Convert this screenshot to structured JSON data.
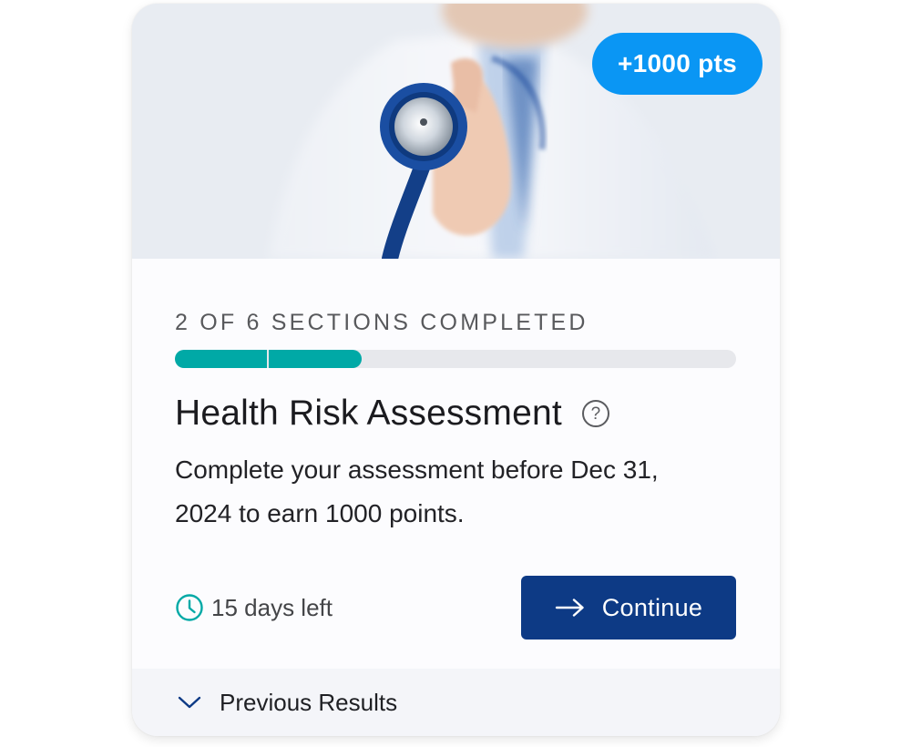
{
  "badge": {
    "text": "+1000 pts",
    "color": "#0a96f4"
  },
  "progress": {
    "label": "2 of 6 sections completed",
    "completed": 2,
    "total": 6,
    "fill_color": "#00a9a6"
  },
  "title": "Health Risk Assessment",
  "help_icon": {
    "glyph": "?",
    "name": "help-circle-icon"
  },
  "description": "Complete your assessment before Dec 31, 2024 to earn 1000 points.",
  "time_left": {
    "text": "15 days left",
    "icon": "clock-icon"
  },
  "continue_button": {
    "label": "Continue",
    "icon": "arrow-right-icon",
    "color": "#0d3a85"
  },
  "footer": {
    "label": "Previous Results",
    "icon": "chevron-down-icon"
  }
}
